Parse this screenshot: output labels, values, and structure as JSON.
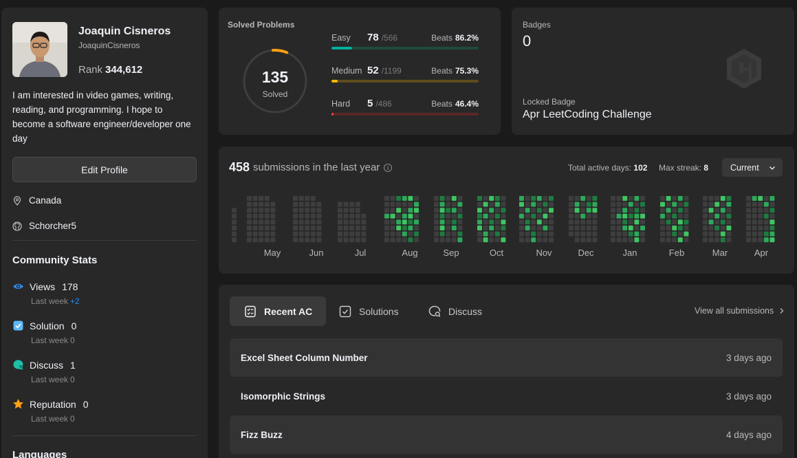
{
  "profile": {
    "name": "Joaquin Cisneros",
    "username": "JoaquinCisneros",
    "rank_label": "Rank",
    "rank_value": "344,612",
    "bio": "I am interested in video games, writing, reading, and programming. I hope to become a software engineer/developer one day",
    "edit_button": "Edit Profile",
    "location": "Canada",
    "github": "Schorcher5",
    "location_icon": "location-pin-icon",
    "github_icon": "github-icon"
  },
  "community": {
    "title": "Community Stats",
    "stats": [
      {
        "label": "Views",
        "value": "178",
        "sub": "Last week",
        "delta": "+2",
        "icon": "eye-icon",
        "color": "#2d8cf0"
      },
      {
        "label": "Solution",
        "value": "0",
        "sub": "Last week",
        "delta": "0",
        "icon": "solution-check-icon",
        "color": "#5bb8f5"
      },
      {
        "label": "Discuss",
        "value": "1",
        "sub": "Last week",
        "delta": "0",
        "icon": "discuss-bubble-icon",
        "color": "#1fbfa6"
      },
      {
        "label": "Reputation",
        "value": "0",
        "sub": "Last week",
        "delta": "0",
        "icon": "star-icon",
        "color": "#ffa116"
      }
    ],
    "languages_title": "Languages"
  },
  "solved": {
    "title": "Solved Problems",
    "total": "135",
    "total_label": "Solved",
    "beats_label": "Beats",
    "difficulties": [
      {
        "name": "Easy",
        "solved": "78",
        "total": "/566",
        "beats": "86.2%",
        "fraction": 0.138,
        "color": "#00af9b",
        "track": "#1e4b3b"
      },
      {
        "name": "Medium",
        "solved": "52",
        "total": "/1199",
        "beats": "75.3%",
        "fraction": 0.043,
        "color": "#ffb800",
        "track": "#5e4e1c"
      },
      {
        "name": "Hard",
        "solved": "5",
        "total": "/486",
        "beats": "46.4%",
        "fraction": 0.01,
        "color": "#ef4743",
        "track": "#5a2727"
      }
    ]
  },
  "badges": {
    "title": "Badges",
    "count": "0",
    "locked_label": "Locked Badge",
    "locked_name": "Apr LeetCoding Challenge",
    "badge_icon": "locked-badge-icon"
  },
  "submissions": {
    "count": "458",
    "title_text": "submissions in the last year",
    "info_icon": "info-icon",
    "active_days_label": "Total active days:",
    "active_days": "102",
    "max_streak_label": "Max streak:",
    "max_streak": "8",
    "period": "Current",
    "months": [
      "May",
      "Jun",
      "Jul",
      "Aug",
      "Sep",
      "Oct",
      "Nov",
      "Dec",
      "Jan",
      "Feb",
      "Mar",
      "Apr"
    ],
    "colors": {
      "empty": "#3e3e3e",
      "light": "#1f7a40",
      "mid": "#2ea85a",
      "high": "#40c463"
    }
  },
  "recent": {
    "tabs": [
      {
        "label": "Recent AC",
        "icon": "recent-ac-icon",
        "active": true
      },
      {
        "label": "Solutions",
        "icon": "solutions-icon",
        "active": false
      },
      {
        "label": "Discuss",
        "icon": "discuss-icon",
        "active": false
      }
    ],
    "view_all": "View all submissions",
    "items": [
      {
        "title": "Excel Sheet Column Number",
        "time": "3 days ago"
      },
      {
        "title": "Isomorphic Strings",
        "time": "3 days ago"
      },
      {
        "title": "Fizz Buzz",
        "time": "4 days ago"
      }
    ]
  }
}
